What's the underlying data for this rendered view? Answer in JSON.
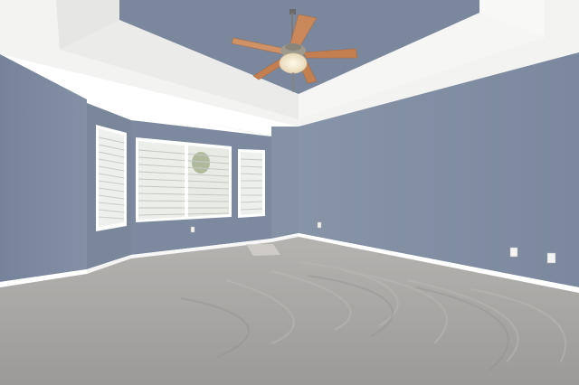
{
  "photo": {
    "subject": "empty room",
    "features": [
      "ceiling-fan",
      "tray-ceiling",
      "bay-window",
      "window-blinds",
      "carpet-floor",
      "baseboards",
      "wall-outlets",
      "floor-vent"
    ]
  },
  "colors": {
    "wall_left": "#7b889c",
    "wall_right": "#7f8ca1",
    "wall_back": "#8591a5",
    "bay_wall": "#7c899e",
    "ceiling": "#f3f3f2",
    "tray_inner": "#7a879c",
    "trim": "#ffffff",
    "carpet": "#a9a7a4",
    "fan_blade": "#c98a5a",
    "window_glass": "#eef0ee"
  }
}
